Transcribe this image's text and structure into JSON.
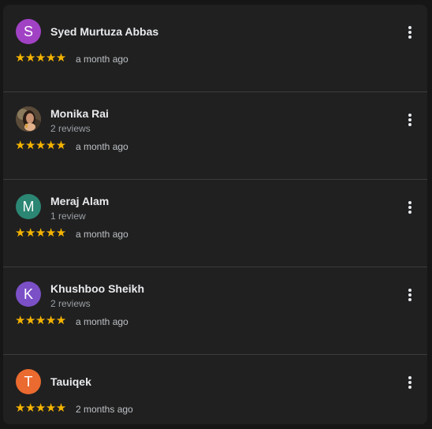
{
  "reviews": [
    {
      "name": "Syed Murtuza Abbas",
      "initial": "S",
      "avatar_color": "#a142c4",
      "sub": "",
      "stars": "★★★★★",
      "rating": 5,
      "time": "a month ago"
    },
    {
      "name": "Monika Rai",
      "initial": "",
      "avatar_color": "#6b5a44",
      "sub": "2 reviews",
      "stars": "★★★★★",
      "rating": 5,
      "time": "a month ago"
    },
    {
      "name": "Meraj Alam",
      "initial": "M",
      "avatar_color": "#2b8673",
      "sub": "1 review",
      "stars": "★★★★★",
      "rating": 5,
      "time": "a month ago"
    },
    {
      "name": "Khushboo Sheikh",
      "initial": "K",
      "avatar_color": "#7b50c7",
      "sub": "2 reviews",
      "stars": "★★★★★",
      "rating": 5,
      "time": "a month ago"
    },
    {
      "name": "Tauiqek",
      "initial": "T",
      "avatar_color": "#ea6a2f",
      "sub": "",
      "stars": "★★★★★",
      "rating": 5,
      "time": "2 months ago"
    }
  ],
  "colors": {
    "star": "#f4b400",
    "background": "#202020",
    "divider": "#3c3c3c"
  },
  "icons": {
    "menu": "more-vert-icon",
    "star": "star-icon"
  }
}
